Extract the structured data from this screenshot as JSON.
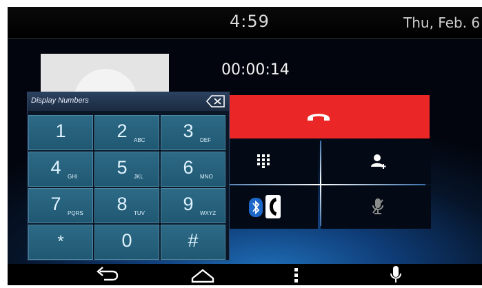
{
  "status_bar": {
    "time": "4:59",
    "date": "Thu, Feb. 6"
  },
  "call": {
    "duration": "00:00:14",
    "end_call_color": "#ea2626"
  },
  "dialpad": {
    "title": "Display Numbers",
    "keys": [
      {
        "digit": "1",
        "letters": ""
      },
      {
        "digit": "2",
        "letters": "ABC"
      },
      {
        "digit": "3",
        "letters": "DEF"
      },
      {
        "digit": "4",
        "letters": "GHI"
      },
      {
        "digit": "5",
        "letters": "JKL"
      },
      {
        "digit": "6",
        "letters": "MNO"
      },
      {
        "digit": "7",
        "letters": "PQRS"
      },
      {
        "digit": "8",
        "letters": "TUV"
      },
      {
        "digit": "9",
        "letters": "WXYZ"
      },
      {
        "digit": "*",
        "letters": ""
      },
      {
        "digit": "0",
        "letters": ""
      },
      {
        "digit": "#",
        "letters": ""
      }
    ]
  },
  "controls": {
    "icons": [
      "keypad-icon",
      "add-contact-icon",
      "bluetooth-icon",
      "handset-icon",
      "mute-mic-icon"
    ]
  },
  "nav_bar": {
    "icons": [
      "back-icon",
      "home-icon",
      "menu-icon",
      "microphone-icon"
    ]
  }
}
